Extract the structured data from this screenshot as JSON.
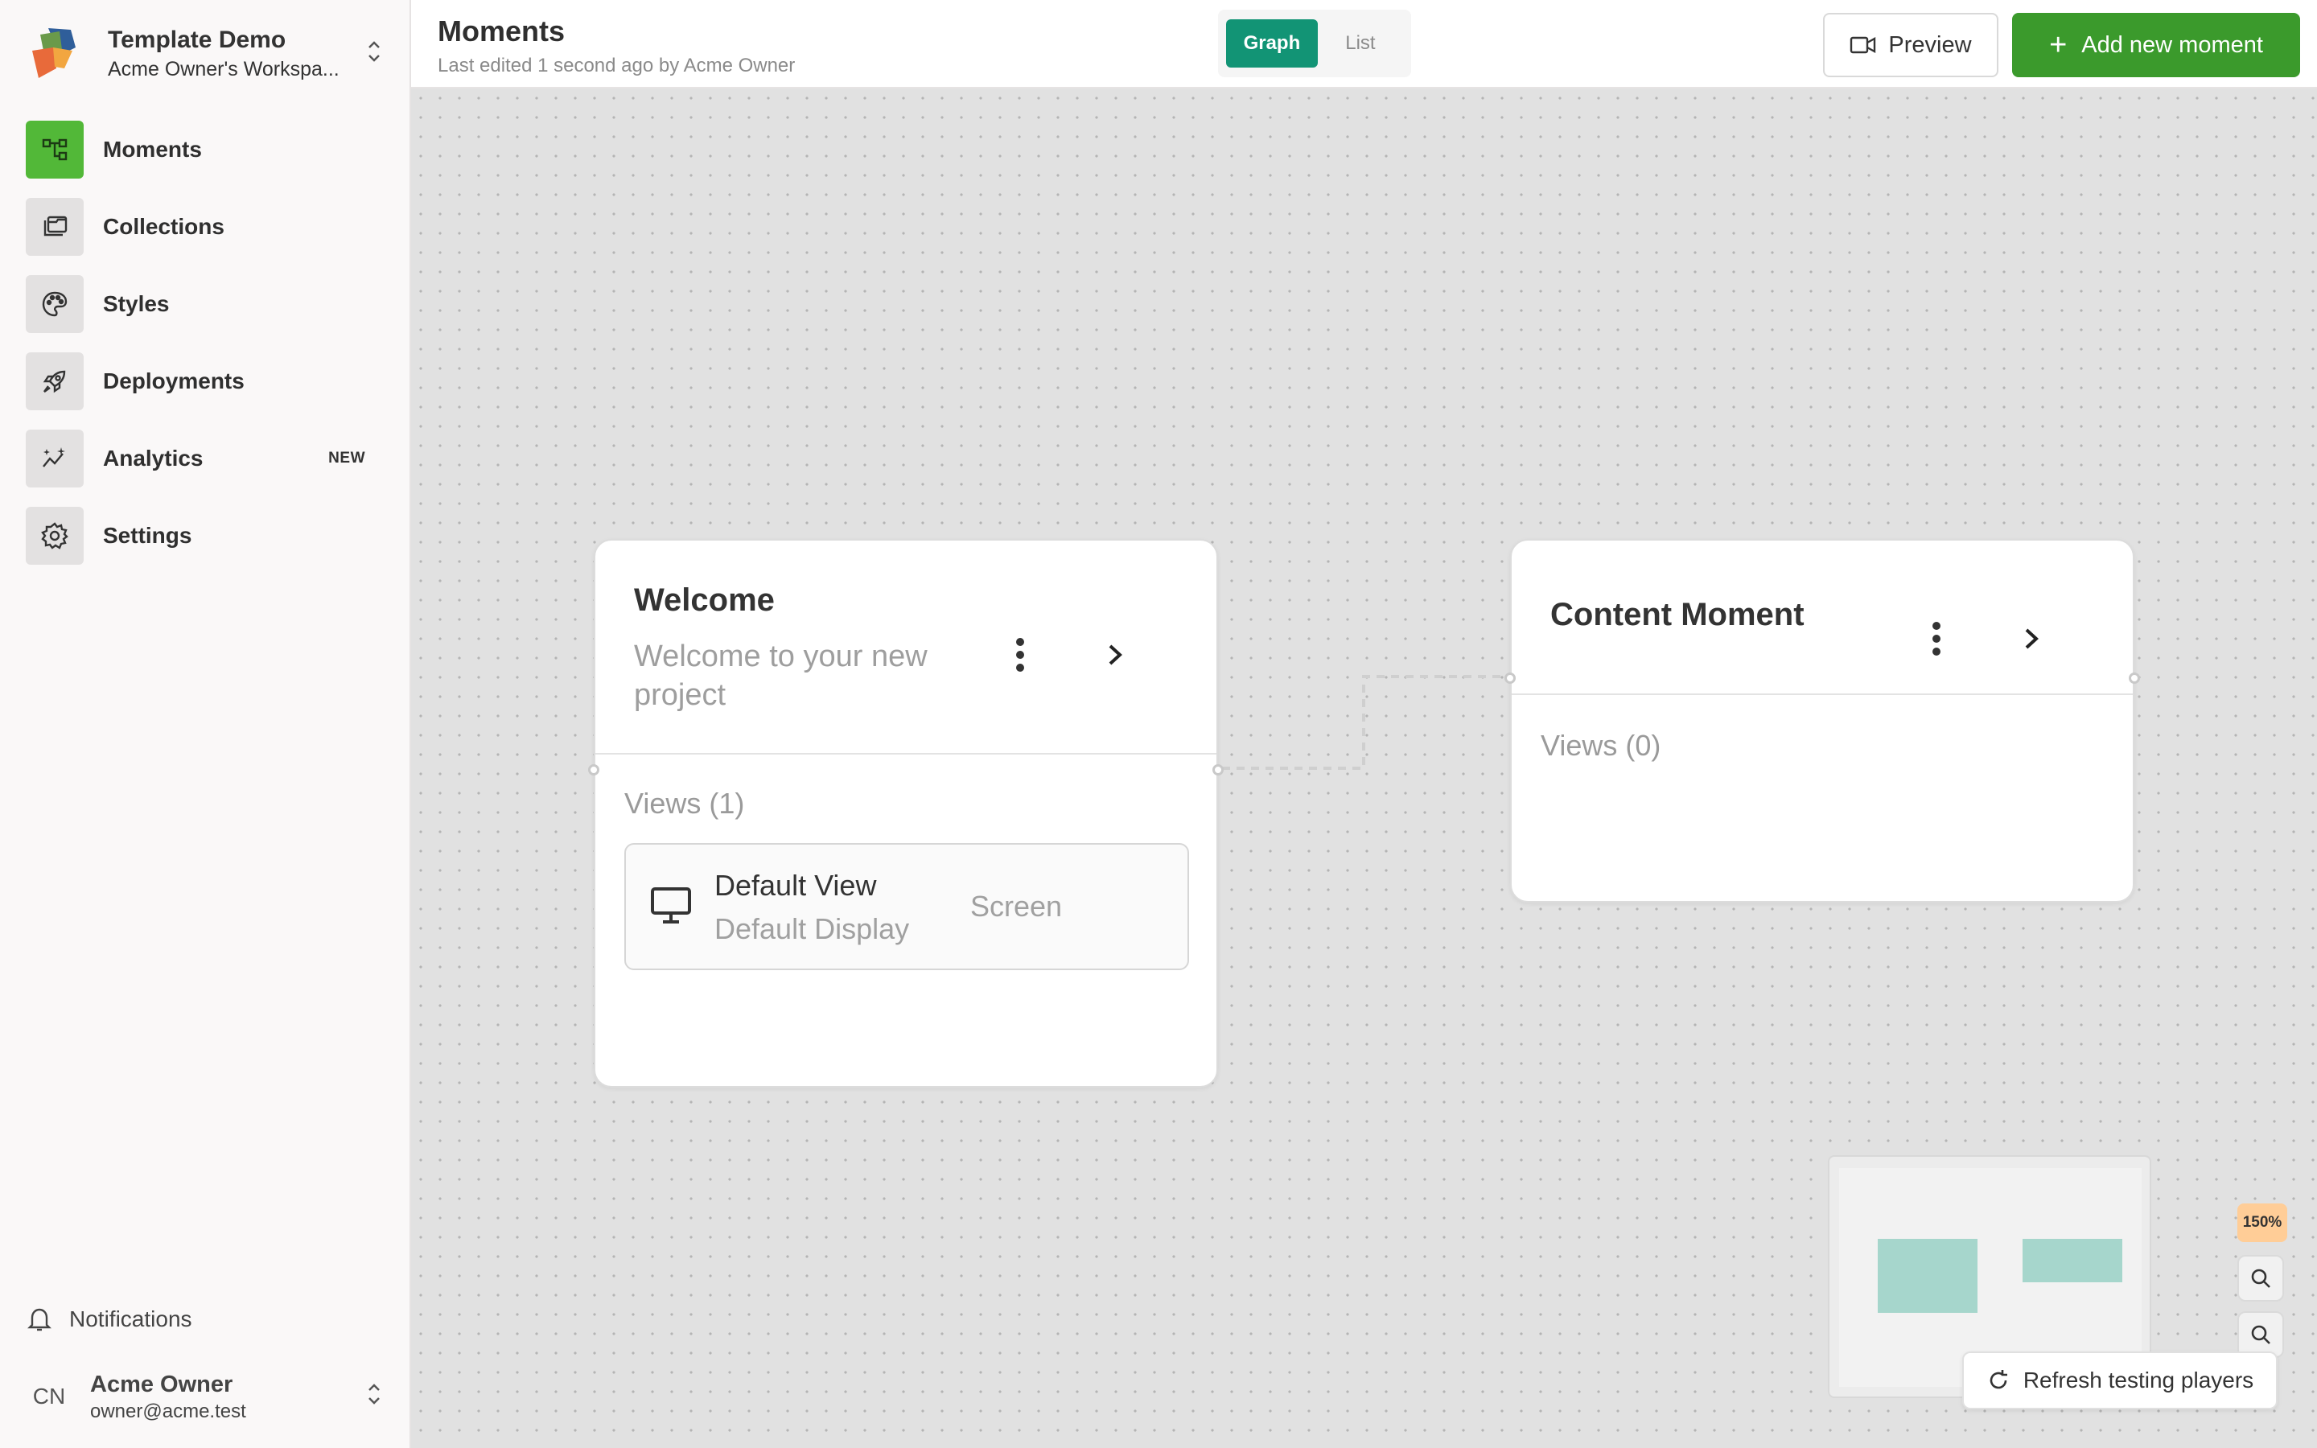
{
  "workspace": {
    "title": "Template Demo",
    "subtitle": "Acme Owner's Workspa..."
  },
  "sidebar": {
    "items": [
      {
        "label": "Moments",
        "icon": "graph-icon",
        "active": true
      },
      {
        "label": "Collections",
        "icon": "collections-icon"
      },
      {
        "label": "Styles",
        "icon": "palette-icon"
      },
      {
        "label": "Deployments",
        "icon": "rocket-icon"
      },
      {
        "label": "Analytics",
        "icon": "sparkle-chart-icon",
        "badge": "NEW"
      },
      {
        "label": "Settings",
        "icon": "gear-icon"
      }
    ],
    "notifications_label": "Notifications",
    "user": {
      "initials": "CN",
      "name": "Acme Owner",
      "email": "owner@acme.test"
    }
  },
  "header": {
    "title": "Moments",
    "subtitle": "Last edited 1 second ago by Acme Owner",
    "view_toggle": {
      "graph": "Graph",
      "list": "List",
      "selected": "Graph"
    },
    "preview_label": "Preview",
    "add_label": "Add new moment"
  },
  "canvas": {
    "moments": [
      {
        "title": "Welcome",
        "description": "Welcome to your new project",
        "views_label": "Views (1)",
        "views": [
          {
            "name": "Default View",
            "display": "Default Display",
            "type": "Screen"
          }
        ]
      },
      {
        "title": "Content Moment",
        "views_label": "Views (0)",
        "views": []
      }
    ],
    "zoom": "150%",
    "refresh_label": "Refresh testing players"
  },
  "colors": {
    "accent_green": "#3b9a2c",
    "active_nav": "#52b838",
    "toggle_teal": "#129475",
    "zoom_badge": "#ffcd97",
    "minimap_node": "#a6d6cc"
  }
}
